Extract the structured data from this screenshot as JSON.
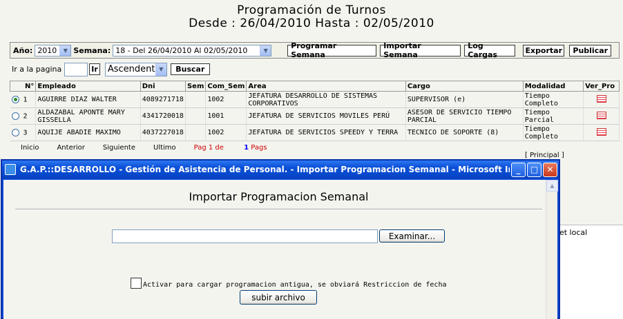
{
  "header": {
    "title": "Programación de Turnos",
    "range": "Desde : 26/04/2010 Hasta : 02/05/2010"
  },
  "toolbar": {
    "year_label": "Año:",
    "year_value": "2010",
    "week_label": "Semana:",
    "week_value": "18 - Del 26/04/2010 Al 02/05/2010",
    "buttons": [
      "Programar Semana",
      "Importar Semana",
      "Log Cargas",
      "Exportar",
      "Publicar"
    ]
  },
  "nav": {
    "goto_label": "Ir a la pagina",
    "go_button": "Ir",
    "sort_value": "Ascendent",
    "search_button": "Buscar"
  },
  "table": {
    "columns": [
      "N°",
      "Empleado",
      "Dni",
      "Sem",
      "Com_Sem",
      "Area",
      "Cargo",
      "Modalidad",
      "Ver_Pro"
    ],
    "rows": [
      {
        "n": "1",
        "empleado": "AGUIRRE DIAZ WALTER",
        "dni": "4089271718",
        "com_sem": "1002",
        "area": "JEFATURA DESARROLLO DE SISTEMAS CORPORATIVOS",
        "cargo": "SUPERVISOR (e)",
        "modalidad": "Tiempo Completo"
      },
      {
        "n": "2",
        "empleado": "ALDAZABAL APONTE MARY GISSELLA",
        "dni": "4341720018",
        "com_sem": "1001",
        "area": "JEFATURA DE SERVICIOS MOVILES PERÚ",
        "cargo": "ASESOR DE SERVICIO TIEMPO PARCIAL",
        "modalidad": "Tiempo Parcial"
      },
      {
        "n": "3",
        "empleado": "AQUIJE ABADIE MAXIMO",
        "dni": "4037227018",
        "com_sem": "1002",
        "area": "JEFATURA DE SERVICIOS SPEEDY Y TERRA",
        "cargo": "TECNICO DE SOPORTE (8)",
        "modalidad": "Tiempo Completo"
      }
    ]
  },
  "pager": {
    "first": "Inicio",
    "prev": "Anterior",
    "next": "Siguiente",
    "last": "Ultimo",
    "page_prefix": "Pag 1 de",
    "page_total": "1",
    "page_suffix": "Pags",
    "principal": "[ Principal ]"
  },
  "popup": {
    "window_title": "G.A.P.::DESARROLLO - Gestión de Asistencia de Personal. - Importar Programacion Semanal - Microsoft Internet ...",
    "heading": "Importar Programacion Semanal",
    "browse_button": "Examinar...",
    "checkbox_label": "Activar para cargar programacion antigua, se obviará Restriccion de fecha",
    "upload_button": "subir archivo"
  },
  "background": {
    "status_fragment": "net local"
  }
}
